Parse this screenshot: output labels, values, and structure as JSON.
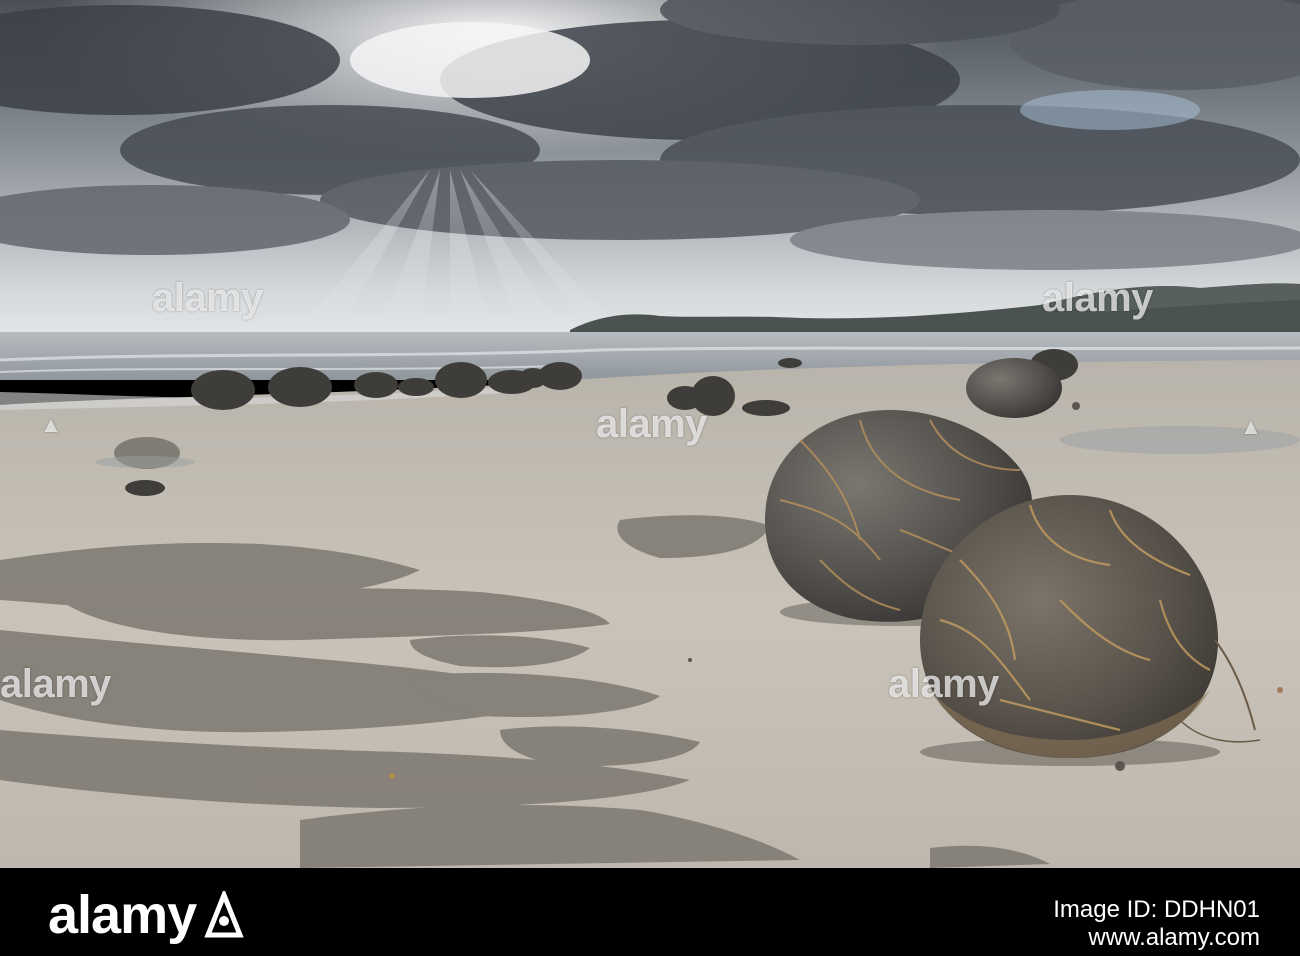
{
  "photo": {
    "watermark_text": "alamy"
  },
  "footer": {
    "logo_text": "alamy",
    "line1": "Image ID: DDHN01",
    "line2": "www.alamy.com"
  },
  "colors": {
    "sky_dark": "#3f444c",
    "sky_light": "#e8ebee",
    "sea": "#9fa6ac",
    "sand": "#c8c2b8",
    "sand_dark": "#8a857d",
    "boulder": "#5b5854",
    "crack": "#b6925e",
    "footer_bg": "#000000"
  }
}
